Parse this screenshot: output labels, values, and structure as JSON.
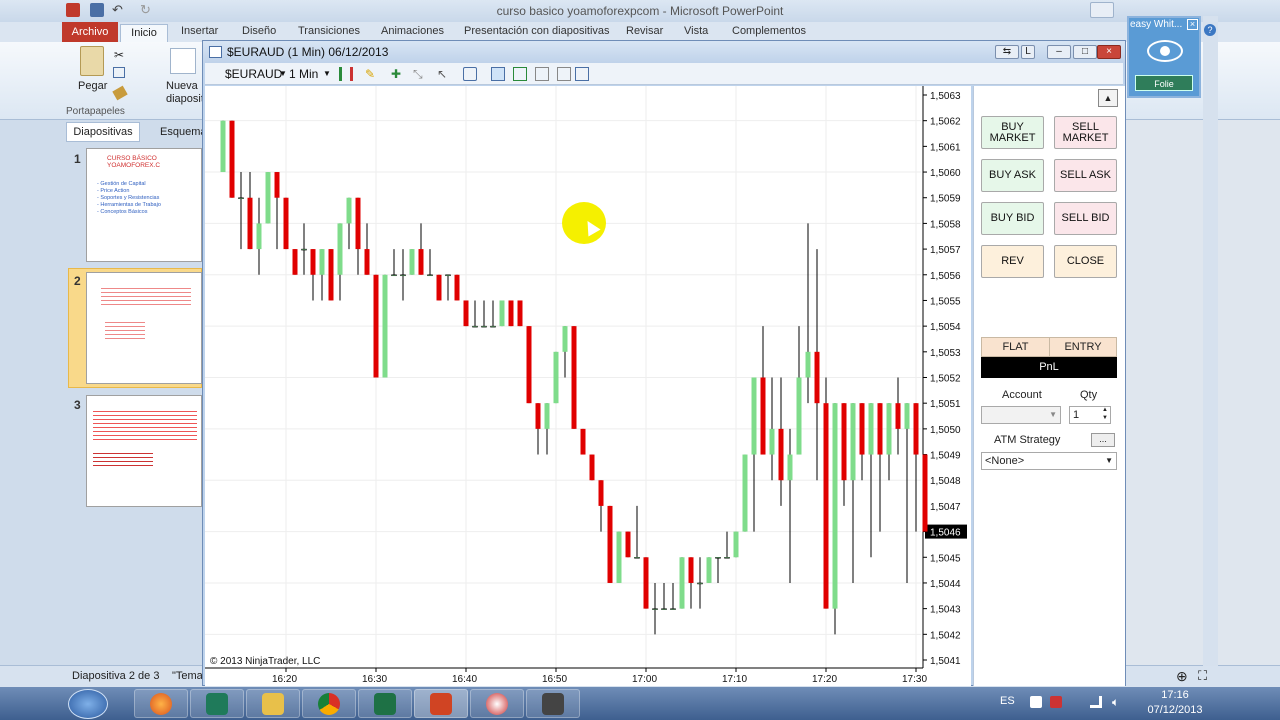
{
  "powerpoint": {
    "window_title": "curso basico yoamoforexpcom  -  Microsoft PowerPoint",
    "tabs": [
      "Archivo",
      "Inicio",
      "Insertar",
      "Diseño",
      "Transiciones",
      "Animaciones",
      "Presentación con diapositivas",
      "Revisar",
      "Vista",
      "Complementos"
    ],
    "ribbon": {
      "paste_label": "Pegar",
      "new_slide_label": "Nueva diapositiva",
      "clipboard_group": "Portapapeles"
    },
    "panel_tabs": [
      "Diapositivas",
      "Esquema"
    ],
    "slides": [
      {
        "num": "1",
        "title": "CURSO BÁSICO YOAMOFOREX.C",
        "lines": [
          "- Gestión de Capital",
          "- Price Action",
          "- Soportes y Resistencias",
          "- Herramientas de Trabajo",
          "- Conceptos Básicos"
        ]
      },
      {
        "num": "2",
        "title": "",
        "lines": []
      },
      {
        "num": "3",
        "title": "",
        "lines": []
      }
    ],
    "status": {
      "slide": "Diapositiva 2 de 3",
      "theme": "\"Tema"
    }
  },
  "ninjatrader": {
    "title": "$EURAUD (1 Min)  06/12/2013",
    "toolbar": {
      "instrument": "$EURAUD",
      "interval": "1 Min"
    },
    "copyright": "© 2013 NinjaTrader, LLC",
    "price_ticks": [
      "1,5063",
      "1,5062",
      "1,5061",
      "1,5060",
      "1,5059",
      "1,5058",
      "1,5057",
      "1,5056",
      "1,5055",
      "1,5054",
      "1,5053",
      "1,5052",
      "1,5051",
      "1,5050",
      "1,5049",
      "1,5048",
      "1,5047",
      "1,5046",
      "1,5045",
      "1,5044",
      "1,5043",
      "1,5042",
      "1,5041"
    ],
    "current_price": "1,5046",
    "time_ticks": [
      "16:20",
      "16:30",
      "16:40",
      "16:50",
      "17:00",
      "17:10",
      "17:20",
      "17:30"
    ],
    "order_panel": {
      "buy_market": "BUY MARKET",
      "sell_market": "SELL MARKET",
      "buy_ask": "BUY ASK",
      "sell_ask": "SELL ASK",
      "buy_bid": "BUY BID",
      "sell_bid": "SELL BID",
      "rev": "REV",
      "close": "CLOSE",
      "flat": "FLAT",
      "entry": "ENTRY",
      "pnl": "PnL",
      "account_label": "Account",
      "qty_label": "Qty",
      "qty_value": "1",
      "atm_label": "ATM Strategy",
      "atm_value": "<None>",
      "ellipsis": "..."
    },
    "colors": {
      "up": "#7fdc8b",
      "down": "#e00000",
      "wick": "#000000"
    }
  },
  "chart_data": {
    "type": "candlestick",
    "price_unit": "EUR/AUD",
    "ylim": [
      1.50405,
      1.50635
    ],
    "xlabel_ticks": [
      "16:20",
      "16:30",
      "16:40",
      "16:50",
      "17:00",
      "17:10",
      "17:20",
      "17:30"
    ],
    "candles": [
      {
        "o": 1.506,
        "h": 1.5062,
        "l": 1.506,
        "c": 1.5062
      },
      {
        "o": 1.5062,
        "h": 1.5062,
        "l": 1.5059,
        "c": 1.5059
      },
      {
        "o": 1.5059,
        "h": 1.506,
        "l": 1.5057,
        "c": 1.5059
      },
      {
        "o": 1.5059,
        "h": 1.506,
        "l": 1.5057,
        "c": 1.5057
      },
      {
        "o": 1.5057,
        "h": 1.5059,
        "l": 1.5056,
        "c": 1.5058
      },
      {
        "o": 1.5058,
        "h": 1.506,
        "l": 1.5058,
        "c": 1.506
      },
      {
        "o": 1.506,
        "h": 1.506,
        "l": 1.5057,
        "c": 1.5059
      },
      {
        "o": 1.5059,
        "h": 1.5059,
        "l": 1.5057,
        "c": 1.5057
      },
      {
        "o": 1.5057,
        "h": 1.5057,
        "l": 1.5056,
        "c": 1.5056
      },
      {
        "o": 1.5057,
        "h": 1.5058,
        "l": 1.5056,
        "c": 1.5057
      },
      {
        "o": 1.5057,
        "h": 1.5057,
        "l": 1.5055,
        "c": 1.5056
      },
      {
        "o": 1.5056,
        "h": 1.5057,
        "l": 1.5055,
        "c": 1.5057
      },
      {
        "o": 1.5057,
        "h": 1.5057,
        "l": 1.5055,
        "c": 1.5055
      },
      {
        "o": 1.5056,
        "h": 1.5058,
        "l": 1.5055,
        "c": 1.5058
      },
      {
        "o": 1.5058,
        "h": 1.5059,
        "l": 1.5057,
        "c": 1.5059
      },
      {
        "o": 1.5059,
        "h": 1.5059,
        "l": 1.5056,
        "c": 1.5057
      },
      {
        "o": 1.5057,
        "h": 1.5058,
        "l": 1.5056,
        "c": 1.5056
      },
      {
        "o": 1.5056,
        "h": 1.5056,
        "l": 1.5052,
        "c": 1.5052
      },
      {
        "o": 1.5052,
        "h": 1.5056,
        "l": 1.5052,
        "c": 1.5056
      },
      {
        "o": 1.5056,
        "h": 1.5057,
        "l": 1.5056,
        "c": 1.5056
      },
      {
        "o": 1.5056,
        "h": 1.5057,
        "l": 1.5055,
        "c": 1.5056
      },
      {
        "o": 1.5056,
        "h": 1.5057,
        "l": 1.5056,
        "c": 1.5057
      },
      {
        "o": 1.5057,
        "h": 1.5058,
        "l": 1.5056,
        "c": 1.5056
      },
      {
        "o": 1.5056,
        "h": 1.5057,
        "l": 1.5056,
        "c": 1.5056
      },
      {
        "o": 1.5056,
        "h": 1.5056,
        "l": 1.5055,
        "c": 1.5055
      },
      {
        "o": 1.5056,
        "h": 1.5056,
        "l": 1.5055,
        "c": 1.5056
      },
      {
        "o": 1.5056,
        "h": 1.5056,
        "l": 1.5055,
        "c": 1.5055
      },
      {
        "o": 1.5055,
        "h": 1.5055,
        "l": 1.5054,
        "c": 1.5054
      },
      {
        "o": 1.5054,
        "h": 1.5055,
        "l": 1.5054,
        "c": 1.5054
      },
      {
        "o": 1.5054,
        "h": 1.5055,
        "l": 1.5054,
        "c": 1.5054
      },
      {
        "o": 1.5054,
        "h": 1.5055,
        "l": 1.5054,
        "c": 1.5054
      },
      {
        "o": 1.5054,
        "h": 1.5055,
        "l": 1.5054,
        "c": 1.5055
      },
      {
        "o": 1.5055,
        "h": 1.5055,
        "l": 1.5054,
        "c": 1.5054
      },
      {
        "o": 1.5055,
        "h": 1.5055,
        "l": 1.5054,
        "c": 1.5054
      },
      {
        "o": 1.5054,
        "h": 1.5054,
        "l": 1.5051,
        "c": 1.5051
      },
      {
        "o": 1.5051,
        "h": 1.5051,
        "l": 1.5049,
        "c": 1.505
      },
      {
        "o": 1.505,
        "h": 1.5051,
        "l": 1.5049,
        "c": 1.5051
      },
      {
        "o": 1.5051,
        "h": 1.5053,
        "l": 1.5051,
        "c": 1.5053
      },
      {
        "o": 1.5053,
        "h": 1.5054,
        "l": 1.5052,
        "c": 1.5054
      },
      {
        "o": 1.5054,
        "h": 1.5054,
        "l": 1.505,
        "c": 1.505
      },
      {
        "o": 1.505,
        "h": 1.505,
        "l": 1.5049,
        "c": 1.5049
      },
      {
        "o": 1.5049,
        "h": 1.5049,
        "l": 1.5048,
        "c": 1.5048
      },
      {
        "o": 1.5048,
        "h": 1.5048,
        "l": 1.5046,
        "c": 1.5047
      },
      {
        "o": 1.5047,
        "h": 1.5047,
        "l": 1.5044,
        "c": 1.5044
      },
      {
        "o": 1.5044,
        "h": 1.5046,
        "l": 1.5044,
        "c": 1.5046
      },
      {
        "o": 1.5046,
        "h": 1.5046,
        "l": 1.5045,
        "c": 1.5045
      },
      {
        "o": 1.5045,
        "h": 1.5047,
        "l": 1.5045,
        "c": 1.5045
      },
      {
        "o": 1.5045,
        "h": 1.5045,
        "l": 1.5043,
        "c": 1.5043
      },
      {
        "o": 1.5043,
        "h": 1.5044,
        "l": 1.5042,
        "c": 1.5043
      },
      {
        "o": 1.5043,
        "h": 1.5044,
        "l": 1.5043,
        "c": 1.5043
      },
      {
        "o": 1.5043,
        "h": 1.5044,
        "l": 1.5043,
        "c": 1.5043
      },
      {
        "o": 1.5043,
        "h": 1.5045,
        "l": 1.5043,
        "c": 1.5045
      },
      {
        "o": 1.5045,
        "h": 1.5045,
        "l": 1.5043,
        "c": 1.5044
      },
      {
        "o": 1.5044,
        "h": 1.5045,
        "l": 1.5043,
        "c": 1.5044
      },
      {
        "o": 1.5044,
        "h": 1.5045,
        "l": 1.5044,
        "c": 1.5045
      },
      {
        "o": 1.5045,
        "h": 1.5045,
        "l": 1.5044,
        "c": 1.5045
      },
      {
        "o": 1.5045,
        "h": 1.5046,
        "l": 1.5045,
        "c": 1.5045
      },
      {
        "o": 1.5045,
        "h": 1.5046,
        "l": 1.5045,
        "c": 1.5046
      },
      {
        "o": 1.5046,
        "h": 1.5049,
        "l": 1.5046,
        "c": 1.5049
      },
      {
        "o": 1.5049,
        "h": 1.5052,
        "l": 1.5046,
        "c": 1.5052
      },
      {
        "o": 1.5052,
        "h": 1.5054,
        "l": 1.5049,
        "c": 1.5049
      },
      {
        "o": 1.5049,
        "h": 1.5052,
        "l": 1.5048,
        "c": 1.505
      },
      {
        "o": 1.505,
        "h": 1.5052,
        "l": 1.5047,
        "c": 1.5048
      },
      {
        "o": 1.5048,
        "h": 1.505,
        "l": 1.5044,
        "c": 1.5049
      },
      {
        "o": 1.5049,
        "h": 1.5054,
        "l": 1.5049,
        "c": 1.5052
      },
      {
        "o": 1.5052,
        "h": 1.5058,
        "l": 1.5051,
        "c": 1.5053
      },
      {
        "o": 1.5053,
        "h": 1.5057,
        "l": 1.5048,
        "c": 1.5051
      },
      {
        "o": 1.5051,
        "h": 1.5052,
        "l": 1.5043,
        "c": 1.5043
      },
      {
        "o": 1.5043,
        "h": 1.5051,
        "l": 1.5042,
        "c": 1.5051
      },
      {
        "o": 1.5051,
        "h": 1.5051,
        "l": 1.5047,
        "c": 1.5048
      },
      {
        "o": 1.5048,
        "h": 1.5051,
        "l": 1.5044,
        "c": 1.5051
      },
      {
        "o": 1.5051,
        "h": 1.5051,
        "l": 1.5048,
        "c": 1.5049
      },
      {
        "o": 1.5049,
        "h": 1.5051,
        "l": 1.5045,
        "c": 1.5051
      },
      {
        "o": 1.5051,
        "h": 1.5051,
        "l": 1.5046,
        "c": 1.5049
      },
      {
        "o": 1.5049,
        "h": 1.5051,
        "l": 1.5048,
        "c": 1.5051
      },
      {
        "o": 1.5051,
        "h": 1.5052,
        "l": 1.5049,
        "c": 1.505
      },
      {
        "o": 1.505,
        "h": 1.5051,
        "l": 1.5044,
        "c": 1.5051
      },
      {
        "o": 1.5051,
        "h": 1.5051,
        "l": 1.5046,
        "c": 1.5049
      },
      {
        "o": 1.5049,
        "h": 1.5049,
        "l": 1.5046,
        "c": 1.5046
      }
    ]
  },
  "easy_whiteboard": {
    "title": "easy Whit...",
    "button": "Folie"
  },
  "taskbar": {
    "lang": "ES",
    "time": "17:16",
    "date": "07/12/2013"
  }
}
